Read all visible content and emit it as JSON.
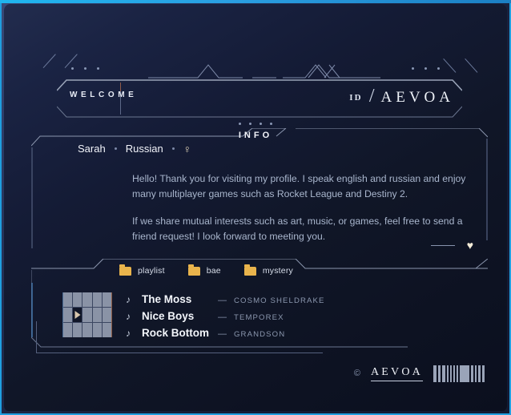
{
  "header": {
    "welcome_label": "WELCOME",
    "id_label": "ID",
    "id_slash": "/",
    "id_name": "AEVOA"
  },
  "info": {
    "section_title": "INFO",
    "name": "Sarah",
    "language": "Russian",
    "gender_icon": "♀",
    "gender_glyph": "venus-symbol",
    "bio_paragraph_1": "Hello! Thank you for visiting my profile. I speak english and russian and enjoy many multiplayer games such as Rocket League and Destiny 2.",
    "bio_paragraph_2": "If we share mutual interests such as art, music, or games, feel free to send a friend request! I look forward to meeting you.",
    "heart_icon": "♥"
  },
  "folders": [
    {
      "label": "playlist",
      "icon": "folder-icon"
    },
    {
      "label": "bae",
      "icon": "folder-icon"
    },
    {
      "label": "mystery",
      "icon": "folder-icon"
    }
  ],
  "player": {
    "play_icon": "play-triangle",
    "note_icon": "♪",
    "dash": "—",
    "tracks": [
      {
        "title": "The Moss",
        "artist": "COSMO SHELDRAKE"
      },
      {
        "title": "Nice Boys",
        "artist": "TEMPOREX"
      },
      {
        "title": "Rock Bottom",
        "artist": "GRANDSON"
      }
    ]
  },
  "footer": {
    "copyright_icon": "©",
    "brand": "AEVOA"
  },
  "colors": {
    "outer_border": "#1f9fe0",
    "folder_accent": "#e9b44c",
    "text_primary": "#f2f5fa",
    "text_muted": "#a9b6cd",
    "line": "#55607e",
    "heart": "#f4ecd8"
  }
}
